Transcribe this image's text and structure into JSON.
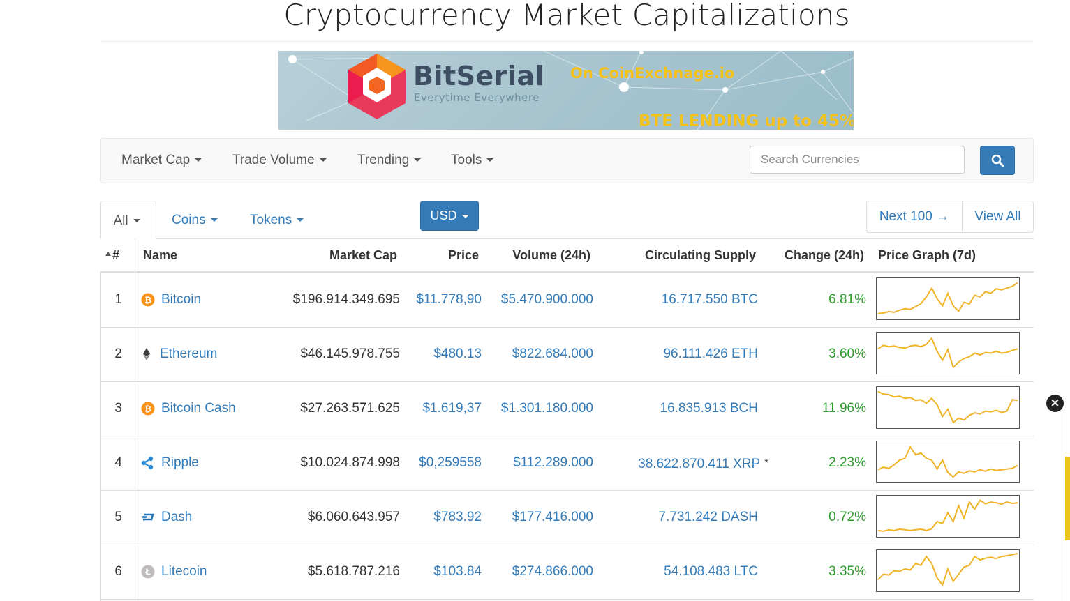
{
  "page": {
    "title": "Cryptocurrency Market Capitalizations"
  },
  "banner": {
    "brand": "BitSerial",
    "tagline": "Everytime Everywhere",
    "exchange": "On CoinExchnage.io",
    "lending": "BTE LENDING up to 45%",
    "colors": {
      "accent": "#f5c21a",
      "brand": "#3f4f63"
    }
  },
  "navbar": {
    "items": [
      {
        "label": "Market Cap"
      },
      {
        "label": "Trade Volume"
      },
      {
        "label": "Trending"
      },
      {
        "label": "Tools"
      }
    ],
    "search": {
      "placeholder": "Search Currencies",
      "value": ""
    }
  },
  "tabs": {
    "all": "All",
    "coins": "Coins",
    "tokens": "Tokens"
  },
  "currency": {
    "selected": "USD"
  },
  "pagination": {
    "next": "Next 100 →",
    "view_all": "View All"
  },
  "table": {
    "headers": {
      "rank": "#",
      "name": "Name",
      "market_cap": "Market Cap",
      "price": "Price",
      "volume": "Volume (24h)",
      "supply": "Circulating Supply",
      "change": "Change (24h)",
      "graph": "Price Graph (7d)"
    },
    "rows": [
      {
        "rank": "1",
        "name": "Bitcoin",
        "icon": "bitcoin-icon",
        "market_cap": "$196.914.349.695",
        "price": "$11.778,90",
        "volume": "$5.470.900.000",
        "supply": "16.717.550 BTC",
        "change": "6.81%",
        "spark": [
          0.08,
          0.1,
          0.14,
          0.12,
          0.18,
          0.22,
          0.2,
          0.28,
          0.36,
          0.55,
          0.8,
          0.5,
          0.3,
          0.65,
          0.3,
          0.15,
          0.4,
          0.35,
          0.6,
          0.55,
          0.7,
          0.65,
          0.78,
          0.75,
          0.8,
          0.85,
          0.95
        ]
      },
      {
        "rank": "2",
        "name": "Ethereum",
        "icon": "ethereum-icon",
        "market_cap": "$46.145.978.755",
        "price": "$480.13",
        "volume": "$822.684.000",
        "supply": "96.111.426 ETH",
        "change": "3.60%",
        "spark": [
          0.62,
          0.72,
          0.68,
          0.7,
          0.66,
          0.64,
          0.7,
          0.72,
          0.68,
          0.75,
          0.92,
          0.55,
          0.3,
          0.6,
          0.1,
          0.25,
          0.35,
          0.4,
          0.5,
          0.45,
          0.52,
          0.5,
          0.55,
          0.5,
          0.52,
          0.58,
          0.62
        ]
      },
      {
        "rank": "3",
        "name": "Bitcoin Cash",
        "icon": "bitcoin-cash-icon",
        "market_cap": "$27.263.571.625",
        "price": "$1.619,37",
        "volume": "$1.301.180.000",
        "supply": "16.835.913 BCH",
        "change": "11.96%",
        "spark": [
          0.95,
          0.88,
          0.86,
          0.8,
          0.82,
          0.76,
          0.78,
          0.7,
          0.72,
          0.62,
          0.76,
          0.58,
          0.25,
          0.45,
          0.08,
          0.2,
          0.15,
          0.28,
          0.35,
          0.32,
          0.4,
          0.38,
          0.42,
          0.36,
          0.4,
          0.72,
          0.7
        ]
      },
      {
        "rank": "4",
        "name": "Ripple",
        "icon": "ripple-icon",
        "market_cap": "$10.024.874.998",
        "price": "$0,259558",
        "volume": "$112.289.000",
        "supply": "38.622.870.411 XRP",
        "supply_note": "*",
        "change": "2.23%",
        "spark": [
          0.28,
          0.35,
          0.32,
          0.42,
          0.55,
          0.6,
          0.92,
          0.7,
          0.75,
          0.6,
          0.55,
          0.3,
          0.55,
          0.2,
          0.08,
          0.22,
          0.18,
          0.25,
          0.22,
          0.28,
          0.24,
          0.3,
          0.26,
          0.28,
          0.3,
          0.32,
          0.4
        ]
      },
      {
        "rank": "5",
        "name": "Dash",
        "icon": "dash-icon",
        "market_cap": "$6.060.643.957",
        "price": "$783.92",
        "volume": "$177.416.000",
        "supply": "7.731.242 DASH",
        "change": "0.72%",
        "spark": [
          0.1,
          0.08,
          0.12,
          0.1,
          0.14,
          0.12,
          0.1,
          0.12,
          0.14,
          0.1,
          0.15,
          0.35,
          0.3,
          0.6,
          0.35,
          0.8,
          0.45,
          0.9,
          0.7,
          0.95,
          0.85,
          0.9,
          0.88,
          0.84,
          0.9,
          0.86,
          0.88
        ]
      },
      {
        "rank": "6",
        "name": "Litecoin",
        "icon": "litecoin-icon",
        "market_cap": "$5.618.787.216",
        "price": "$103.84",
        "volume": "$274.866.000",
        "supply": "54.108.483 LTC",
        "change": "3.35%",
        "spark": [
          0.25,
          0.4,
          0.38,
          0.5,
          0.48,
          0.55,
          0.52,
          0.7,
          0.65,
          0.9,
          0.7,
          0.3,
          0.1,
          0.55,
          0.2,
          0.4,
          0.6,
          0.65,
          0.9,
          0.8,
          0.85,
          0.88,
          0.84,
          0.9,
          0.92,
          0.95,
          0.98
        ]
      }
    ],
    "colors": {
      "link": "#337ab7",
      "positive": "#2d9c2d",
      "spark": "#f0b429"
    }
  }
}
